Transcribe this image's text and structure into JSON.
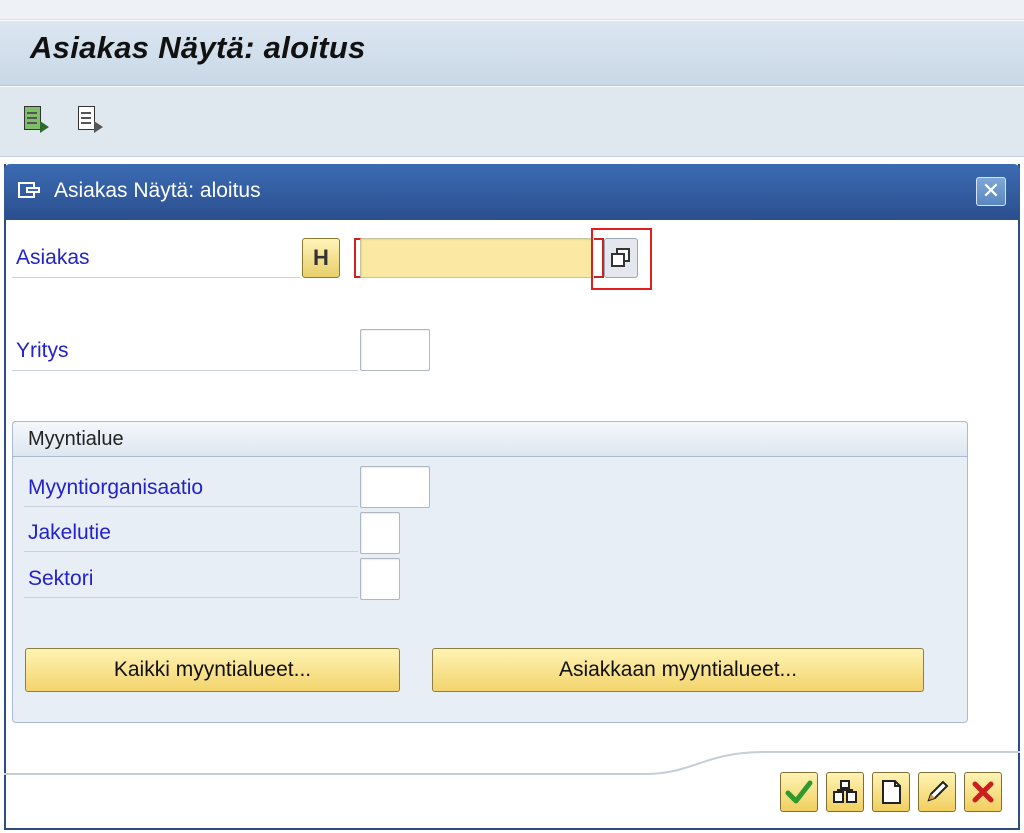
{
  "screen": {
    "title": "Asiakas Näytä: aloitus"
  },
  "toolbar": {
    "icons": [
      "execute-icon",
      "display-icon"
    ]
  },
  "dialog": {
    "title": "Asiakas Näytä: aloitus",
    "close_symbol": "✕",
    "fields": {
      "asiakas": {
        "label": "Asiakas",
        "value": ""
      },
      "yritys": {
        "label": "Yritys",
        "value": ""
      }
    },
    "sales_area": {
      "title": "Myyntialue",
      "fields": [
        {
          "label": "Myyntiorganisaatio",
          "value": ""
        },
        {
          "label": "Jakelutie",
          "value": ""
        },
        {
          "label": "Sektori",
          "value": ""
        }
      ],
      "buttons": {
        "all_areas": "Kaikki myyntialueet...",
        "customer_areas": "Asiakkaan myyntialueet..."
      }
    },
    "actions": [
      "continue-icon",
      "hierarchy-icon",
      "new-document-icon",
      "edit-icon",
      "cancel-icon"
    ],
    "colors": {
      "title_bar": "#2a4f8f",
      "label": "#2222cc",
      "required_field": "#fbe8a3",
      "highlight": "#e02020",
      "button": "#f3d46e"
    }
  }
}
